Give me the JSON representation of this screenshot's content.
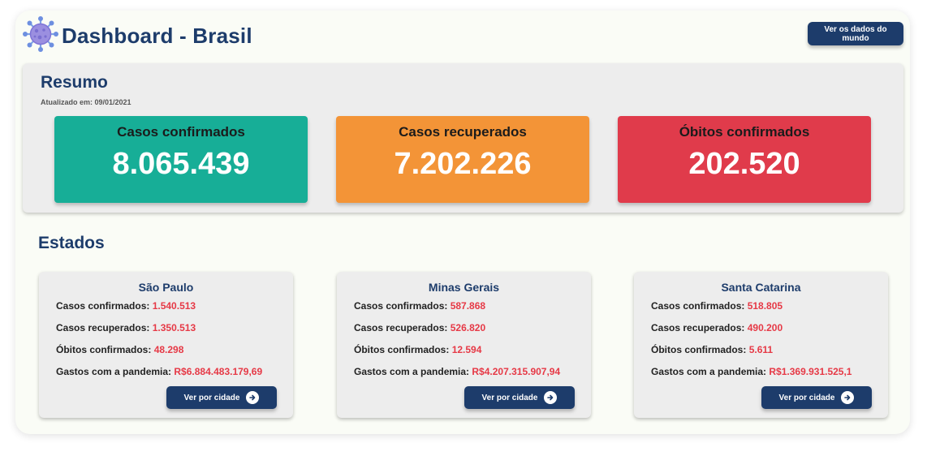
{
  "header": {
    "title": "Dashboard - Brasil",
    "world_button": "Ver os dados do mundo",
    "logo_icon": "virus-icon"
  },
  "resumo": {
    "title": "Resumo",
    "updated": "Atualizado em: 09/01/2021",
    "cards": [
      {
        "label": "Casos confirmados",
        "value": "8.065.439",
        "color": "#17ae97"
      },
      {
        "label": "Casos recuperados",
        "value": "7.202.226",
        "color": "#f39437"
      },
      {
        "label": "Óbitos confirmados",
        "value": "202.520",
        "color": "#e03b4b"
      }
    ]
  },
  "estados": {
    "title": "Estados",
    "labels": {
      "confirmed": "Casos confirmados:",
      "recovered": "Casos recuperados:",
      "deaths": "Óbitos confirmados:",
      "spending": "Gastos com a pandemia:"
    },
    "button_label": "Ver por cidade",
    "button_icon": "arrow-right-circle-icon",
    "items": [
      {
        "name": "São Paulo",
        "confirmed": "1.540.513",
        "recovered": "1.350.513",
        "deaths": "48.298",
        "spending": "R$6.884.483.179,69"
      },
      {
        "name": "Minas Gerais",
        "confirmed": "587.868",
        "recovered": "526.820",
        "deaths": "12.594",
        "spending": "R$4.207.315.907,94"
      },
      {
        "name": "Santa Catarina",
        "confirmed": "518.805",
        "recovered": "490.200",
        "deaths": "5.611",
        "spending": "R$1.369.931.525,1"
      }
    ]
  },
  "colors": {
    "navy": "#1d3c6b",
    "value_red": "#e63946",
    "panel": "#ededed"
  }
}
